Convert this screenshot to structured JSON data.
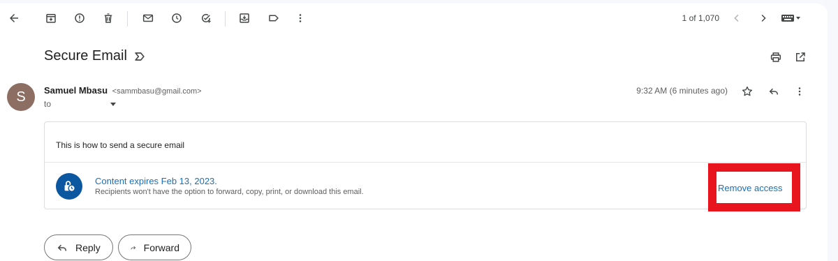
{
  "toolbar": {
    "pager": "1 of 1,070",
    "icons": [
      "back-arrow-icon",
      "archive-icon",
      "report-spam-icon",
      "delete-icon",
      "mark-unread-icon",
      "snooze-icon",
      "add-task-icon",
      "move-to-icon",
      "label-icon",
      "more-vert-icon",
      "chevron-left-icon",
      "chevron-right-icon",
      "keyboard-icon"
    ]
  },
  "email": {
    "subject": "Secure Email",
    "sender_name": "Samuel Mbasu",
    "sender_email": "<sammbasu@gmail.com>",
    "avatar_initial": "S",
    "avatar_color": "#8d6e63",
    "to_label": "to",
    "timestamp": "9:32 AM (6 minutes ago)",
    "body": "This is how to send a secure email"
  },
  "confidential": {
    "title": "Content expires Feb 13, 2023.",
    "description": "Recipients won't have the option to forward, copy, print, or download this email.",
    "remove_access": "Remove access",
    "icon_color": "#0b57a0",
    "highlight_color": "#e8141e"
  },
  "actions": {
    "reply": "Reply",
    "forward": "Forward"
  }
}
